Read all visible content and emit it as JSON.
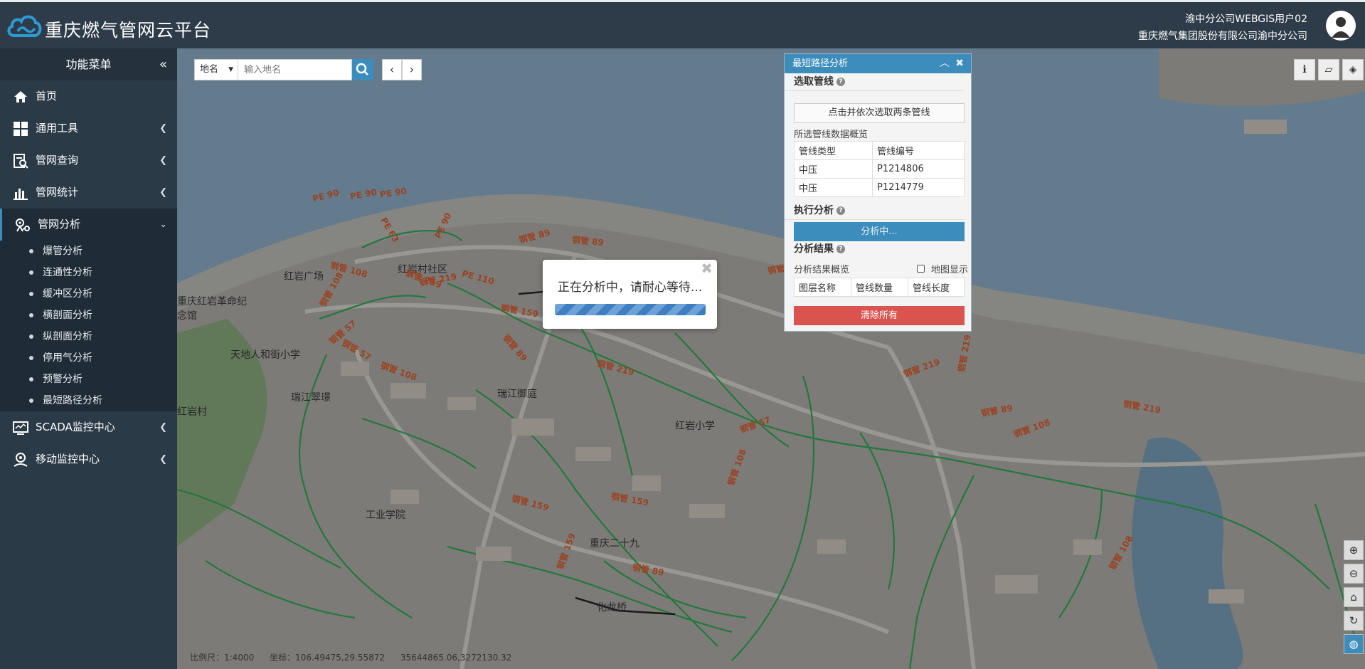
{
  "header": {
    "app_title": "重庆燃气管网云平台",
    "user_name": "渝中分公司WEBGIS用户02",
    "user_company": "重庆燃气集团股份有限公司渝中分公司"
  },
  "sidebar": {
    "title": "功能菜单",
    "collapse_glyph": "«",
    "items": [
      {
        "label": "首页",
        "icon": "home-icon"
      },
      {
        "label": "通用工具",
        "icon": "grid-icon"
      },
      {
        "label": "管网查询",
        "icon": "search-document-icon"
      },
      {
        "label": "管网统计",
        "icon": "bar-chart-icon"
      },
      {
        "label": "管网分析",
        "icon": "pipe-analysis-icon",
        "expanded": true
      },
      {
        "label": "SCADA监控中心",
        "icon": "monitor-chart-icon"
      },
      {
        "label": "移动监控中心",
        "icon": "user-location-icon"
      }
    ],
    "sub_items": [
      "爆管分析",
      "连通性分析",
      "缓冲区分析",
      "横剖面分析",
      "纵剖面分析",
      "停用气分析",
      "预警分析",
      "最短路径分析"
    ]
  },
  "search": {
    "type_label": "地名",
    "placeholder": "输入地名"
  },
  "map_labels": {
    "places": [
      "红岩广场",
      "红岩村社区",
      "重庆红岩革命纪念馆",
      "天地人和街小学",
      "红岩村",
      "瑞江翠璟",
      "瑞江御庭",
      "红岩小学",
      "工业学院",
      "重庆二十九",
      "化龙桥"
    ],
    "pipes": [
      "PE 90",
      "PE 90",
      "PE 90",
      "PE 90",
      "PE 63",
      "钢管 89",
      "钢管 89",
      "钢管 108",
      "钢管 108",
      "钢管 57",
      "钢管 57",
      "钢管 219",
      "钢管 219",
      "钢管 219",
      "钢管 219",
      "钢管 159",
      "钢管 159",
      "钢管 159",
      "PE 110",
      "钢管 108",
      "钢管 89",
      "钢管 89",
      "钢管 57",
      "钢管 89",
      "钢管 219",
      "钢管 108",
      "钢管 159",
      "钢管 89",
      "钢管 219",
      "钢管 108",
      "钢管 108"
    ]
  },
  "status": {
    "scale": "比例尺：1:4000",
    "coord": "坐标：106.49475,29.55872",
    "projected": "35644865.06,3272130.32"
  },
  "panel": {
    "title": "最短路径分析",
    "select_section": "选取管线",
    "pick_button": "点击并依次选取两条管线",
    "overview_label": "所选管线数据概览",
    "pipe_table_headers": [
      "管线类型",
      "管线编号"
    ],
    "pipe_rows": [
      [
        "中压",
        "P1214806"
      ],
      [
        "中压",
        "P1214779"
      ]
    ],
    "exec_section": "执行分析",
    "analyze_button": "分析中...",
    "result_section": "分析结果",
    "result_overview_label": "分析结果概览",
    "map_display_label": "地图显示",
    "result_headers": [
      "图层名称",
      "管线数量",
      "管线长度"
    ],
    "clear_button": "清除所有"
  },
  "modal": {
    "message": "正在分析中，请耐心等待..."
  },
  "colors": {
    "header_bg": "#2e3b48",
    "accent": "#3c8dbc",
    "danger": "#d9534f",
    "pipe_green": "#1d8a3c",
    "pipe_label": "#b5451b"
  }
}
